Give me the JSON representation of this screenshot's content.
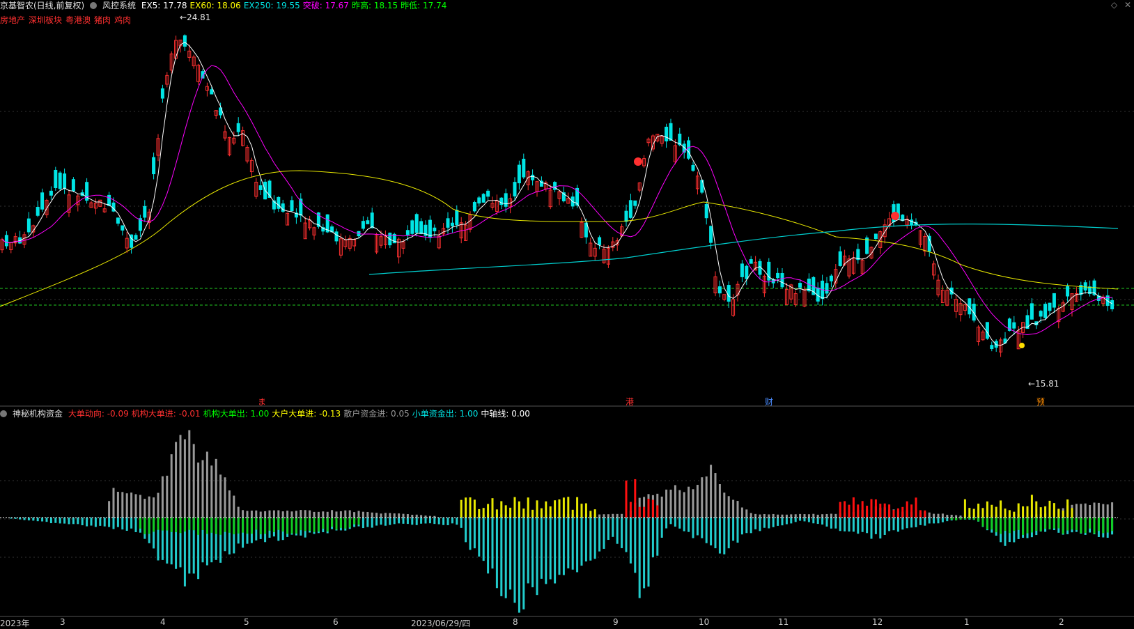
{
  "header": {
    "stock": "京基智农(日线,前复权)",
    "system": "风控系统",
    "indicators": [
      {
        "label": "EX5: 17.78",
        "color": "#ffffff"
      },
      {
        "label": "EX60: 18.06",
        "color": "#ffff00"
      },
      {
        "label": "EX250: 19.55",
        "color": "#00e5e5"
      },
      {
        "label": "突破: 17.67",
        "color": "#ff00ff"
      },
      {
        "label": "昨高: 18.15",
        "color": "#00ff00"
      },
      {
        "label": "昨低: 17.74",
        "color": "#00ff00"
      }
    ],
    "tags": [
      "房地产",
      "深圳板块",
      "粤港澳",
      "猪肉",
      "鸡肉"
    ]
  },
  "price_labels": {
    "high": "24.81",
    "low": "15.81"
  },
  "event_markers": [
    {
      "label": "ま",
      "color": "#ff3030"
    },
    {
      "label": "港",
      "color": "#ff3030"
    },
    {
      "label": "财",
      "color": "#4a8cff"
    },
    {
      "label": "预",
      "color": "#ff8c00"
    }
  ],
  "indicator_panel": {
    "name": "神秘机构资金",
    "values": [
      {
        "label": "大单动向: -0.09",
        "color": "#ff3030"
      },
      {
        "label": "机构大单进: -0.01",
        "color": "#ff3030"
      },
      {
        "label": "机构大单出: 1.00",
        "color": "#00ff00"
      },
      {
        "label": "大户大单进: -0.13",
        "color": "#ffff00"
      },
      {
        "label": "散户资金进: 0.05",
        "color": "#999999"
      },
      {
        "label": "小单资金出: 1.00",
        "color": "#00e5e5"
      },
      {
        "label": "中轴线: 0.00",
        "color": "#ffffff"
      }
    ]
  },
  "x_axis": [
    "2023年",
    "3",
    "4",
    "5",
    "6",
    "2023/06/29/四",
    "8",
    "9",
    "10",
    "11",
    "12",
    "1",
    "2"
  ],
  "colors": {
    "up": "#ff3030",
    "down": "#00e5e5",
    "ma5": "#ffffff",
    "ma20": "#ff00ff",
    "ma60": "#e8e800",
    "ma250": "#00d0d0"
  },
  "window_icons": [
    "diamond-icon",
    "close-icon"
  ]
}
